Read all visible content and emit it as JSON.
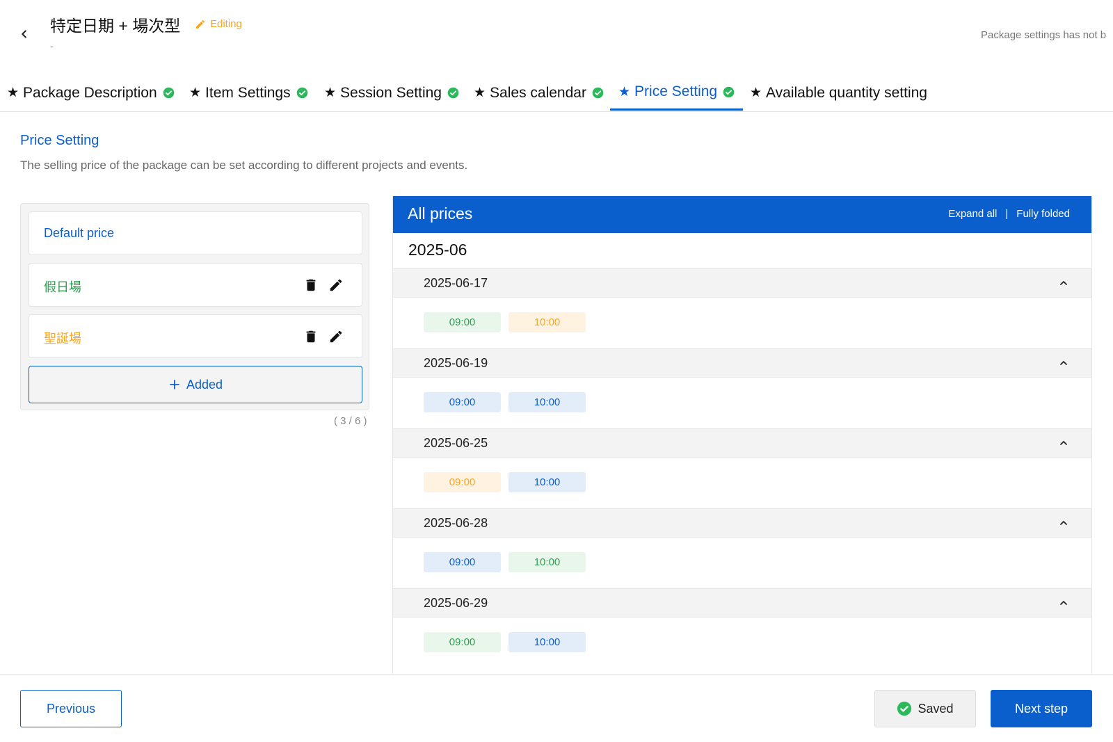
{
  "header": {
    "title": "特定日期 + 場次型",
    "editing_label": "Editing",
    "subtitle": "-",
    "notice": "Package settings has not b"
  },
  "tabs": [
    {
      "star": "★",
      "label": "Package Description",
      "done": true,
      "active": false
    },
    {
      "star": "★",
      "label": "Item Settings",
      "done": true,
      "active": false
    },
    {
      "star": "★",
      "label": "Session Setting",
      "done": true,
      "active": false
    },
    {
      "star": "★",
      "label": "Sales calendar",
      "done": true,
      "active": false
    },
    {
      "star": "★",
      "label": "Price Setting",
      "done": true,
      "active": true
    },
    {
      "star": "★",
      "label": "Available quantity setting",
      "done": false,
      "active": false
    }
  ],
  "section": {
    "title": "Price Setting",
    "description": "The selling price of the package can be set according to different projects and events."
  },
  "price_list": {
    "items": [
      {
        "label": "Default price",
        "color": "#0b5fcc"
      },
      {
        "label": "假日場",
        "color": "#2e9e4f"
      },
      {
        "label": "聖誕場",
        "color": "#f5a623"
      }
    ],
    "add_label": "Added",
    "counter": "( 3 / 6 )"
  },
  "all_prices": {
    "title": "All prices",
    "expand_all": "Expand all",
    "separator": "|",
    "fully_folded": "Fully folded",
    "month": "2025-06",
    "days": [
      {
        "date": "2025-06-17",
        "slots": [
          {
            "time": "09:00",
            "tone": "green"
          },
          {
            "time": "10:00",
            "tone": "orange"
          }
        ]
      },
      {
        "date": "2025-06-19",
        "slots": [
          {
            "time": "09:00",
            "tone": "blue"
          },
          {
            "time": "10:00",
            "tone": "blue"
          }
        ]
      },
      {
        "date": "2025-06-25",
        "slots": [
          {
            "time": "09:00",
            "tone": "orange"
          },
          {
            "time": "10:00",
            "tone": "blue"
          }
        ]
      },
      {
        "date": "2025-06-28",
        "slots": [
          {
            "time": "09:00",
            "tone": "blue"
          },
          {
            "time": "10:00",
            "tone": "green"
          }
        ]
      },
      {
        "date": "2025-06-29",
        "slots": [
          {
            "time": "09:00",
            "tone": "green"
          },
          {
            "time": "10:00",
            "tone": "blue"
          }
        ]
      }
    ]
  },
  "footer": {
    "previous": "Previous",
    "saved": "Saved",
    "next": "Next step"
  },
  "colors": {
    "primary": "#0b5fcc",
    "success": "#2e9e4f",
    "warning": "#f5a623"
  }
}
